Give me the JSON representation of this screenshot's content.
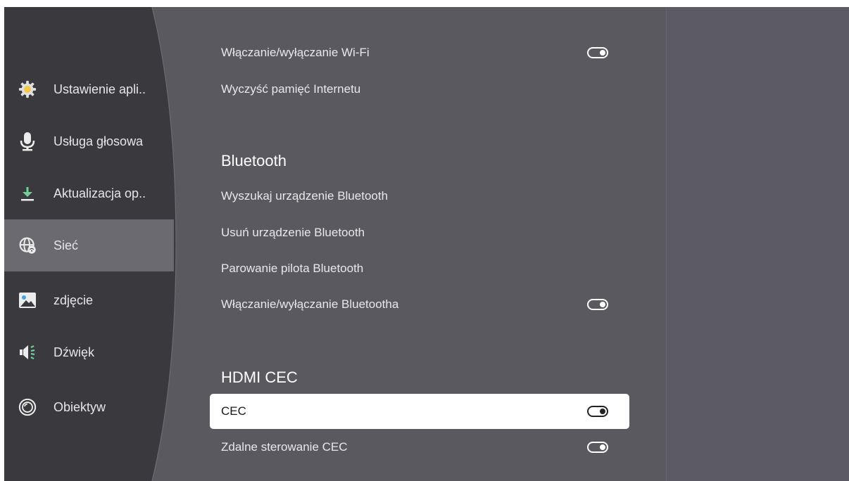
{
  "colors": {
    "sidebar_bg": "#3a3a3e",
    "content_bg": "#5a5960",
    "selected_bg": "#6a6a70",
    "focus_bg": "#ffffff",
    "settings_icon_yellow": "#f2c94c",
    "download_icon_green": "#6fcf97"
  },
  "sidebar": {
    "items": [
      {
        "label": "Ustawienie apli..",
        "icon": "gear-icon"
      },
      {
        "label": "Usługa głosowa",
        "icon": "microphone-icon"
      },
      {
        "label": "Aktualizacja op..",
        "icon": "download-icon"
      },
      {
        "label": "Sieć",
        "icon": "network-globe-icon",
        "selected": true
      },
      {
        "label": "zdjęcie",
        "icon": "picture-icon"
      },
      {
        "label": "Dźwięk",
        "icon": "speaker-icon"
      },
      {
        "label": "Obiektyw",
        "icon": "lens-icon"
      }
    ]
  },
  "main": {
    "wifi_toggle_label": "Włączanie/wyłączanie Wi-Fi",
    "clear_cache_label": "Wyczyść pamięć Internetu",
    "bluetooth_header": "Bluetooth",
    "bt_search_label": "Wyszukaj urządzenie Bluetooth",
    "bt_remove_label": "Usuń urządzenie Bluetooth",
    "bt_pair_remote_label": "Parowanie pilota Bluetooth",
    "bt_toggle_label": "Włączanie/wyłączanie Bluetootha",
    "hdmi_header": "HDMI CEC",
    "cec_label": "CEC",
    "cec_remote_label": "Zdalne sterowanie CEC"
  }
}
